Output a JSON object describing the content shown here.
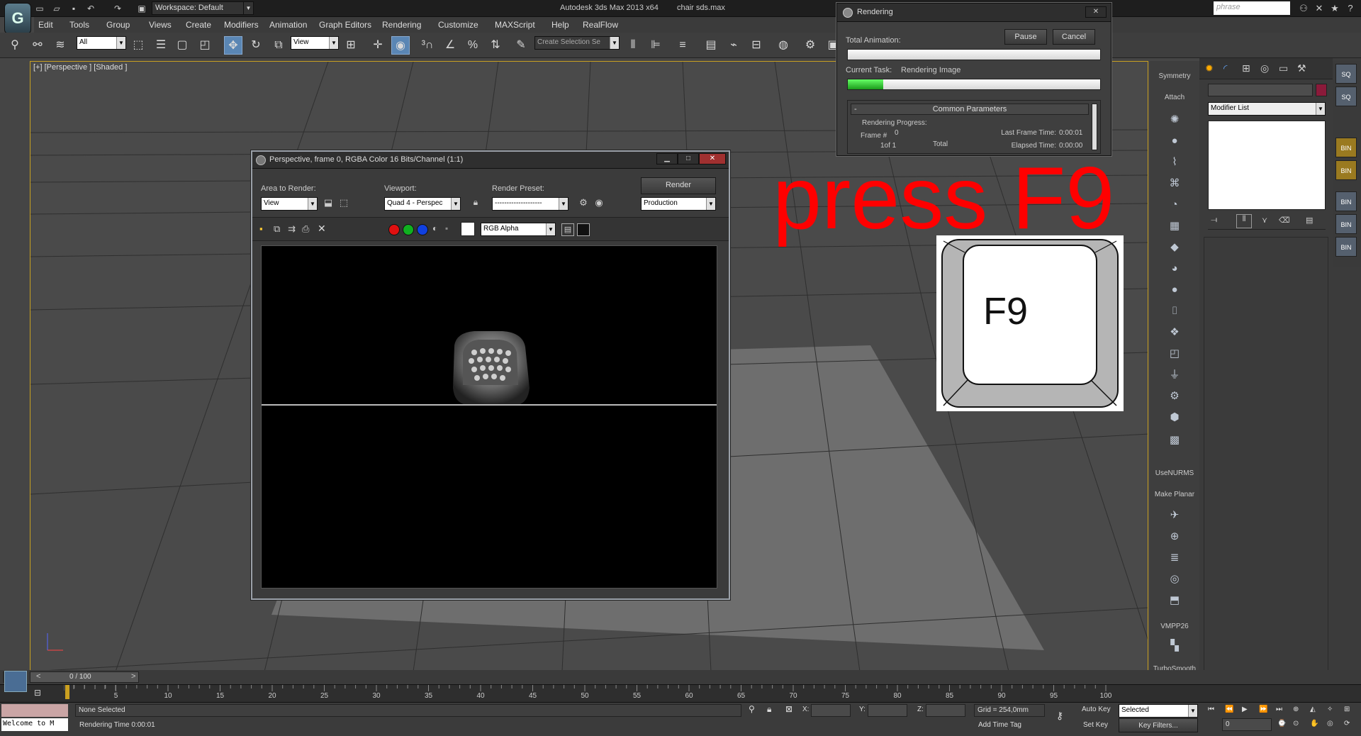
{
  "titlebar": {
    "workspace": "Workspace: Default",
    "app_title": "Autodesk 3ds Max  2013 x64",
    "file_title": "chair sds.max",
    "search_placeholder": "phrase"
  },
  "menubar": [
    "Edit",
    "Tools",
    "Group",
    "Views",
    "Create",
    "Modifiers",
    "Animation",
    "Graph Editors",
    "Rendering",
    "Customize",
    "MAXScript",
    "Help",
    "RealFlow"
  ],
  "toolbar": {
    "selection_filter": "All",
    "ref_coord": "View",
    "named_selection": "Create Selection Se"
  },
  "viewport": {
    "label": "[+] [Perspective ] [Shaded ]"
  },
  "rendering_dialog": {
    "title": "Rendering",
    "pause": "Pause",
    "cancel": "Cancel",
    "total_animation_label": "Total Animation:",
    "current_task_label": "Current Task:",
    "current_task_value": "Rendering Image",
    "total_progress": 0.0,
    "task_progress": 0.14,
    "section_title": "Common Parameters",
    "rendering_progress_label": "Rendering Progress:",
    "frame_label": "Frame #",
    "frame_value": "0",
    "frame_count": "1of 1",
    "total_label": "Total",
    "last_frame_time_label": "Last Frame Time:",
    "last_frame_time_value": "0:00:01",
    "elapsed_time_label": "Elapsed Time:",
    "elapsed_time_value": "0:00:00"
  },
  "frame_window": {
    "title": "Perspective, frame 0, RGBA Color 16 Bits/Channel (1:1)",
    "area_label": "Area to Render:",
    "area_value": "View",
    "viewport_label": "Viewport:",
    "viewport_value": "Quad 4 - Perspec",
    "preset_label": "Render Preset:",
    "preset_value": "--------------------",
    "render_button": "Render",
    "production": "Production",
    "channel": "RGB Alpha"
  },
  "overlay": {
    "press_text": "press F9",
    "key_label": "F9"
  },
  "command_panel": {
    "modifier_list": "Modifier List",
    "stack_buttons": [
      "Symmetry",
      "Attach",
      "UseNURMS",
      "Make Planar",
      "VMPP26",
      "TurboSmooth"
    ]
  },
  "timeline": {
    "frame_counter": "0 / 100",
    "ticks": [
      "5",
      "10",
      "15",
      "20",
      "25",
      "30",
      "35",
      "40",
      "45",
      "50",
      "55",
      "60",
      "65",
      "70",
      "75",
      "80",
      "85",
      "90",
      "95",
      "100"
    ]
  },
  "statusbar": {
    "maxscript": "Welcome to M",
    "selection": "None Selected",
    "rendering_time": "Rendering Time  0:00:01",
    "x_label": "X:",
    "y_label": "Y:",
    "z_label": "Z:",
    "grid": "Grid = 254,0mm",
    "add_time_tag": "Add Time Tag",
    "auto_key": "Auto Key",
    "set_key": "Set Key",
    "selected": "Selected",
    "key_filters": "Key Filters...",
    "frame_field": "0"
  },
  "colors": {
    "accent_blue": "#5a86b4",
    "viewport_border": "#c8a020",
    "overlay_red": "#ff0000",
    "progress_green": "#33cc33"
  }
}
